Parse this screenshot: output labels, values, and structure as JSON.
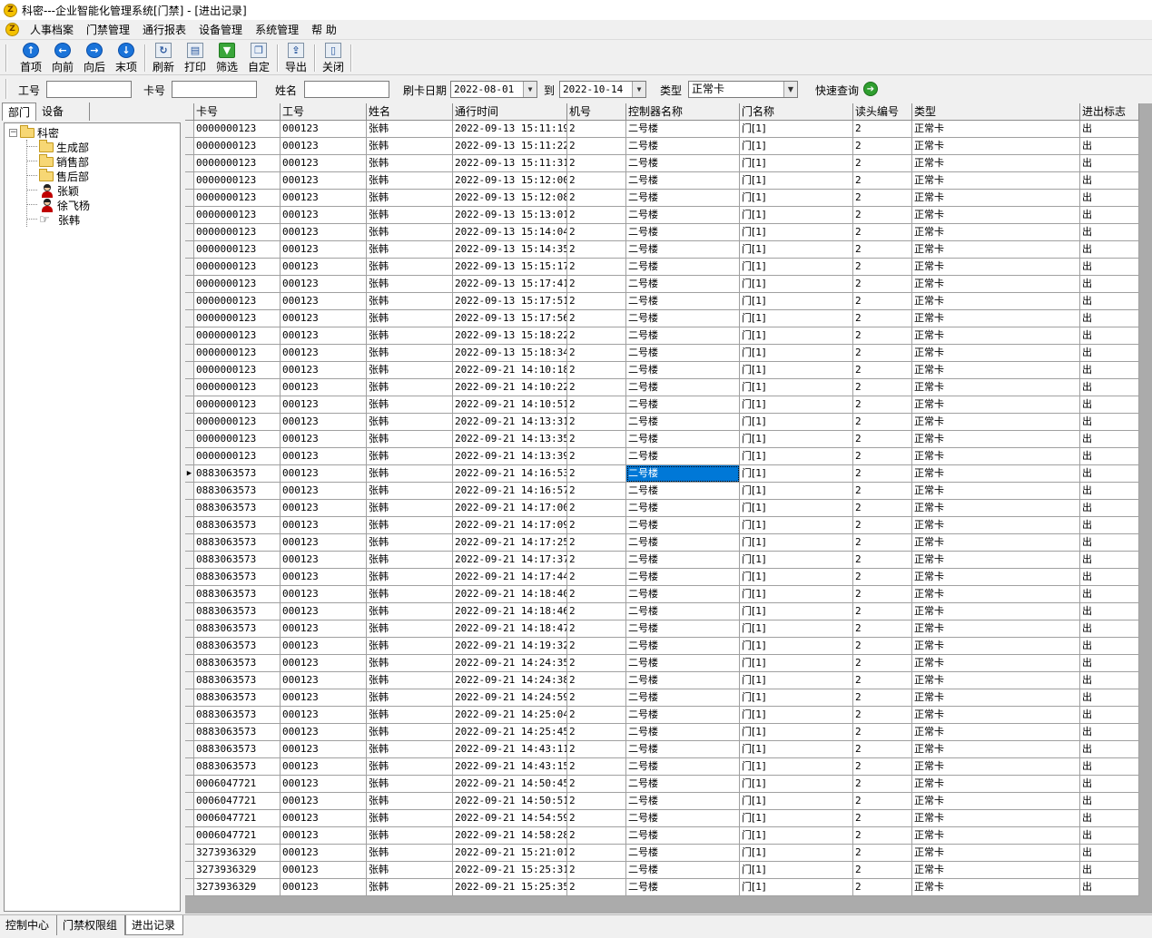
{
  "window": {
    "title": "科密---企业智能化管理系统[门禁] - [进出记录]",
    "icon_letter": "Z"
  },
  "menu": [
    {
      "label": "人事档案"
    },
    {
      "label": "门禁管理"
    },
    {
      "label": "通行报表"
    },
    {
      "label": "设备管理"
    },
    {
      "label": "系统管理"
    },
    {
      "label": "帮 助"
    }
  ],
  "toolbar": {
    "buttons": [
      {
        "label": "首项",
        "icon": "first-record-icon"
      },
      {
        "label": "向前",
        "icon": "previous-record-icon"
      },
      {
        "label": "向后",
        "icon": "next-record-icon"
      },
      {
        "label": "末项",
        "icon": "last-record-icon"
      },
      {
        "label": "刷新",
        "icon": "refresh-icon"
      },
      {
        "label": "打印",
        "icon": "printer-icon"
      },
      {
        "label": "筛选",
        "icon": "filter-icon"
      },
      {
        "label": "自定",
        "icon": "customize-icon"
      },
      {
        "label": "导出",
        "icon": "export-icon"
      },
      {
        "label": "关闭",
        "icon": "close-icon"
      }
    ]
  },
  "filter": {
    "emp_id_label": "工号",
    "emp_id_value": "",
    "card_label": "卡号",
    "card_value": "",
    "name_label": "姓名",
    "name_value": "",
    "date_label": "刷卡日期",
    "date_from": "2022-08-01",
    "to_label": "到",
    "date_to": "2022-10-14",
    "type_label": "类型",
    "type_value": "正常卡",
    "quick_query_label": "快速查询"
  },
  "left_panel": {
    "tabs": [
      "部门",
      "设备"
    ],
    "tree": {
      "root": "科密",
      "departments": [
        "生成部",
        "销售部",
        "售后部"
      ],
      "people": [
        "张颖",
        "徐飞杨",
        "张韩"
      ]
    }
  },
  "grid": {
    "columns": [
      "卡号",
      "工号",
      "姓名",
      "通行时间",
      "机号",
      "控制器名称",
      "门名称",
      "读头编号",
      "类型",
      "进出标志"
    ],
    "current_row": 20,
    "selected_col": 5,
    "rows": [
      [
        "0000000123",
        "000123",
        "张韩",
        "2022-09-13 15:11:19",
        "2",
        "二号楼",
        "门[1]",
        "2",
        "正常卡",
        "出"
      ],
      [
        "0000000123",
        "000123",
        "张韩",
        "2022-09-13 15:11:22",
        "2",
        "二号楼",
        "门[1]",
        "2",
        "正常卡",
        "出"
      ],
      [
        "0000000123",
        "000123",
        "张韩",
        "2022-09-13 15:11:31",
        "2",
        "二号楼",
        "门[1]",
        "2",
        "正常卡",
        "出"
      ],
      [
        "0000000123",
        "000123",
        "张韩",
        "2022-09-13 15:12:00",
        "2",
        "二号楼",
        "门[1]",
        "2",
        "正常卡",
        "出"
      ],
      [
        "0000000123",
        "000123",
        "张韩",
        "2022-09-13 15:12:08",
        "2",
        "二号楼",
        "门[1]",
        "2",
        "正常卡",
        "出"
      ],
      [
        "0000000123",
        "000123",
        "张韩",
        "2022-09-13 15:13:01",
        "2",
        "二号楼",
        "门[1]",
        "2",
        "正常卡",
        "出"
      ],
      [
        "0000000123",
        "000123",
        "张韩",
        "2022-09-13 15:14:04",
        "2",
        "二号楼",
        "门[1]",
        "2",
        "正常卡",
        "出"
      ],
      [
        "0000000123",
        "000123",
        "张韩",
        "2022-09-13 15:14:35",
        "2",
        "二号楼",
        "门[1]",
        "2",
        "正常卡",
        "出"
      ],
      [
        "0000000123",
        "000123",
        "张韩",
        "2022-09-13 15:15:17",
        "2",
        "二号楼",
        "门[1]",
        "2",
        "正常卡",
        "出"
      ],
      [
        "0000000123",
        "000123",
        "张韩",
        "2022-09-13 15:17:41",
        "2",
        "二号楼",
        "门[1]",
        "2",
        "正常卡",
        "出"
      ],
      [
        "0000000123",
        "000123",
        "张韩",
        "2022-09-13 15:17:51",
        "2",
        "二号楼",
        "门[1]",
        "2",
        "正常卡",
        "出"
      ],
      [
        "0000000123",
        "000123",
        "张韩",
        "2022-09-13 15:17:56",
        "2",
        "二号楼",
        "门[1]",
        "2",
        "正常卡",
        "出"
      ],
      [
        "0000000123",
        "000123",
        "张韩",
        "2022-09-13 15:18:22",
        "2",
        "二号楼",
        "门[1]",
        "2",
        "正常卡",
        "出"
      ],
      [
        "0000000123",
        "000123",
        "张韩",
        "2022-09-13 15:18:34",
        "2",
        "二号楼",
        "门[1]",
        "2",
        "正常卡",
        "出"
      ],
      [
        "0000000123",
        "000123",
        "张韩",
        "2022-09-21 14:10:18",
        "2",
        "二号楼",
        "门[1]",
        "2",
        "正常卡",
        "出"
      ],
      [
        "0000000123",
        "000123",
        "张韩",
        "2022-09-21 14:10:22",
        "2",
        "二号楼",
        "门[1]",
        "2",
        "正常卡",
        "出"
      ],
      [
        "0000000123",
        "000123",
        "张韩",
        "2022-09-21 14:10:51",
        "2",
        "二号楼",
        "门[1]",
        "2",
        "正常卡",
        "出"
      ],
      [
        "0000000123",
        "000123",
        "张韩",
        "2022-09-21 14:13:31",
        "2",
        "二号楼",
        "门[1]",
        "2",
        "正常卡",
        "出"
      ],
      [
        "0000000123",
        "000123",
        "张韩",
        "2022-09-21 14:13:35",
        "2",
        "二号楼",
        "门[1]",
        "2",
        "正常卡",
        "出"
      ],
      [
        "0000000123",
        "000123",
        "张韩",
        "2022-09-21 14:13:39",
        "2",
        "二号楼",
        "门[1]",
        "2",
        "正常卡",
        "出"
      ],
      [
        "0883063573",
        "000123",
        "张韩",
        "2022-09-21 14:16:53",
        "2",
        "二号楼",
        "门[1]",
        "2",
        "正常卡",
        "出"
      ],
      [
        "0883063573",
        "000123",
        "张韩",
        "2022-09-21 14:16:57",
        "2",
        "二号楼",
        "门[1]",
        "2",
        "正常卡",
        "出"
      ],
      [
        "0883063573",
        "000123",
        "张韩",
        "2022-09-21 14:17:00",
        "2",
        "二号楼",
        "门[1]",
        "2",
        "正常卡",
        "出"
      ],
      [
        "0883063573",
        "000123",
        "张韩",
        "2022-09-21 14:17:09",
        "2",
        "二号楼",
        "门[1]",
        "2",
        "正常卡",
        "出"
      ],
      [
        "0883063573",
        "000123",
        "张韩",
        "2022-09-21 14:17:25",
        "2",
        "二号楼",
        "门[1]",
        "2",
        "正常卡",
        "出"
      ],
      [
        "0883063573",
        "000123",
        "张韩",
        "2022-09-21 14:17:37",
        "2",
        "二号楼",
        "门[1]",
        "2",
        "正常卡",
        "出"
      ],
      [
        "0883063573",
        "000123",
        "张韩",
        "2022-09-21 14:17:44",
        "2",
        "二号楼",
        "门[1]",
        "2",
        "正常卡",
        "出"
      ],
      [
        "0883063573",
        "000123",
        "张韩",
        "2022-09-21 14:18:40",
        "2",
        "二号楼",
        "门[1]",
        "2",
        "正常卡",
        "出"
      ],
      [
        "0883063573",
        "000123",
        "张韩",
        "2022-09-21 14:18:46",
        "2",
        "二号楼",
        "门[1]",
        "2",
        "正常卡",
        "出"
      ],
      [
        "0883063573",
        "000123",
        "张韩",
        "2022-09-21 14:18:47",
        "2",
        "二号楼",
        "门[1]",
        "2",
        "正常卡",
        "出"
      ],
      [
        "0883063573",
        "000123",
        "张韩",
        "2022-09-21 14:19:32",
        "2",
        "二号楼",
        "门[1]",
        "2",
        "正常卡",
        "出"
      ],
      [
        "0883063573",
        "000123",
        "张韩",
        "2022-09-21 14:24:35",
        "2",
        "二号楼",
        "门[1]",
        "2",
        "正常卡",
        "出"
      ],
      [
        "0883063573",
        "000123",
        "张韩",
        "2022-09-21 14:24:38",
        "2",
        "二号楼",
        "门[1]",
        "2",
        "正常卡",
        "出"
      ],
      [
        "0883063573",
        "000123",
        "张韩",
        "2022-09-21 14:24:59",
        "2",
        "二号楼",
        "门[1]",
        "2",
        "正常卡",
        "出"
      ],
      [
        "0883063573",
        "000123",
        "张韩",
        "2022-09-21 14:25:04",
        "2",
        "二号楼",
        "门[1]",
        "2",
        "正常卡",
        "出"
      ],
      [
        "0883063573",
        "000123",
        "张韩",
        "2022-09-21 14:25:45",
        "2",
        "二号楼",
        "门[1]",
        "2",
        "正常卡",
        "出"
      ],
      [
        "0883063573",
        "000123",
        "张韩",
        "2022-09-21 14:43:11",
        "2",
        "二号楼",
        "门[1]",
        "2",
        "正常卡",
        "出"
      ],
      [
        "0883063573",
        "000123",
        "张韩",
        "2022-09-21 14:43:15",
        "2",
        "二号楼",
        "门[1]",
        "2",
        "正常卡",
        "出"
      ],
      [
        "0006047721",
        "000123",
        "张韩",
        "2022-09-21 14:50:45",
        "2",
        "二号楼",
        "门[1]",
        "2",
        "正常卡",
        "出"
      ],
      [
        "0006047721",
        "000123",
        "张韩",
        "2022-09-21 14:50:51",
        "2",
        "二号楼",
        "门[1]",
        "2",
        "正常卡",
        "出"
      ],
      [
        "0006047721",
        "000123",
        "张韩",
        "2022-09-21 14:54:59",
        "2",
        "二号楼",
        "门[1]",
        "2",
        "正常卡",
        "出"
      ],
      [
        "0006047721",
        "000123",
        "张韩",
        "2022-09-21 14:58:28",
        "2",
        "二号楼",
        "门[1]",
        "2",
        "正常卡",
        "出"
      ],
      [
        "3273936329",
        "000123",
        "张韩",
        "2022-09-21 15:21:01",
        "2",
        "二号楼",
        "门[1]",
        "2",
        "正常卡",
        "出"
      ],
      [
        "3273936329",
        "000123",
        "张韩",
        "2022-09-21 15:25:31",
        "2",
        "二号楼",
        "门[1]",
        "2",
        "正常卡",
        "出"
      ],
      [
        "3273936329",
        "000123",
        "张韩",
        "2022-09-21 15:25:35",
        "2",
        "二号楼",
        "门[1]",
        "2",
        "正常卡",
        "出"
      ]
    ]
  },
  "bottom_tabs": {
    "items": [
      "控制中心",
      "门禁权限组",
      "进出记录"
    ],
    "active": 2
  }
}
